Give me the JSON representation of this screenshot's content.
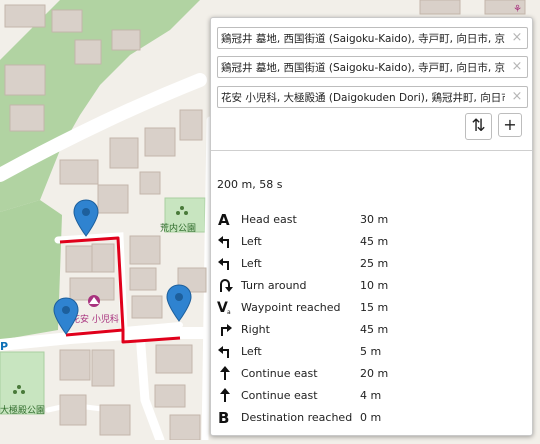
{
  "map": {
    "labels": {
      "park_top": "荒内公園",
      "clinic": "花安 小児科",
      "park_bottom": "大極殿公園",
      "parking": "P"
    }
  },
  "routing_panel": {
    "waypoints": [
      {
        "value": "鶏冠井 墓地, 西国街道 (Saigoku-Kaido), 寺戸町, 向日市, 京都府"
      },
      {
        "value": "鶏冠井 墓地, 西国街道 (Saigoku-Kaido), 寺戸町, 向日市, 京都府"
      },
      {
        "value": "花安 小児科, 大極殿通 (Daigokuden Dori), 鶏冠井町, 向日市, 京都府"
      }
    ],
    "remove_glyph": "×",
    "reverse_glyph": "⇅",
    "add_glyph": "+",
    "summary": "200 m, 58 s",
    "instructions": [
      {
        "icon": "depart-icon",
        "text": "Head east",
        "distance": "30 m"
      },
      {
        "icon": "turn-left-icon",
        "text": "Left",
        "distance": "45 m"
      },
      {
        "icon": "turn-left-icon",
        "text": "Left",
        "distance": "25 m"
      },
      {
        "icon": "u-turn-icon",
        "text": "Turn around",
        "distance": "10 m"
      },
      {
        "icon": "waypoint-icon",
        "text": "Waypoint reached",
        "distance": "15 m"
      },
      {
        "icon": "turn-right-icon",
        "text": "Right",
        "distance": "45 m"
      },
      {
        "icon": "turn-left-icon",
        "text": "Left",
        "distance": "5 m"
      },
      {
        "icon": "continue-icon",
        "text": "Continue east",
        "distance": "20 m"
      },
      {
        "icon": "continue-icon",
        "text": "Continue east",
        "distance": "4 m"
      },
      {
        "icon": "arrive-icon",
        "text": "Destination reached",
        "distance": "0 m"
      }
    ]
  },
  "colors": {
    "route": "#e0001b",
    "marker": "#2f83d0",
    "park": "#c8e5c0",
    "woodland": "#add19e",
    "building": "#d9d0c9",
    "road": "#ffffff",
    "poi": "#a8327e"
  }
}
